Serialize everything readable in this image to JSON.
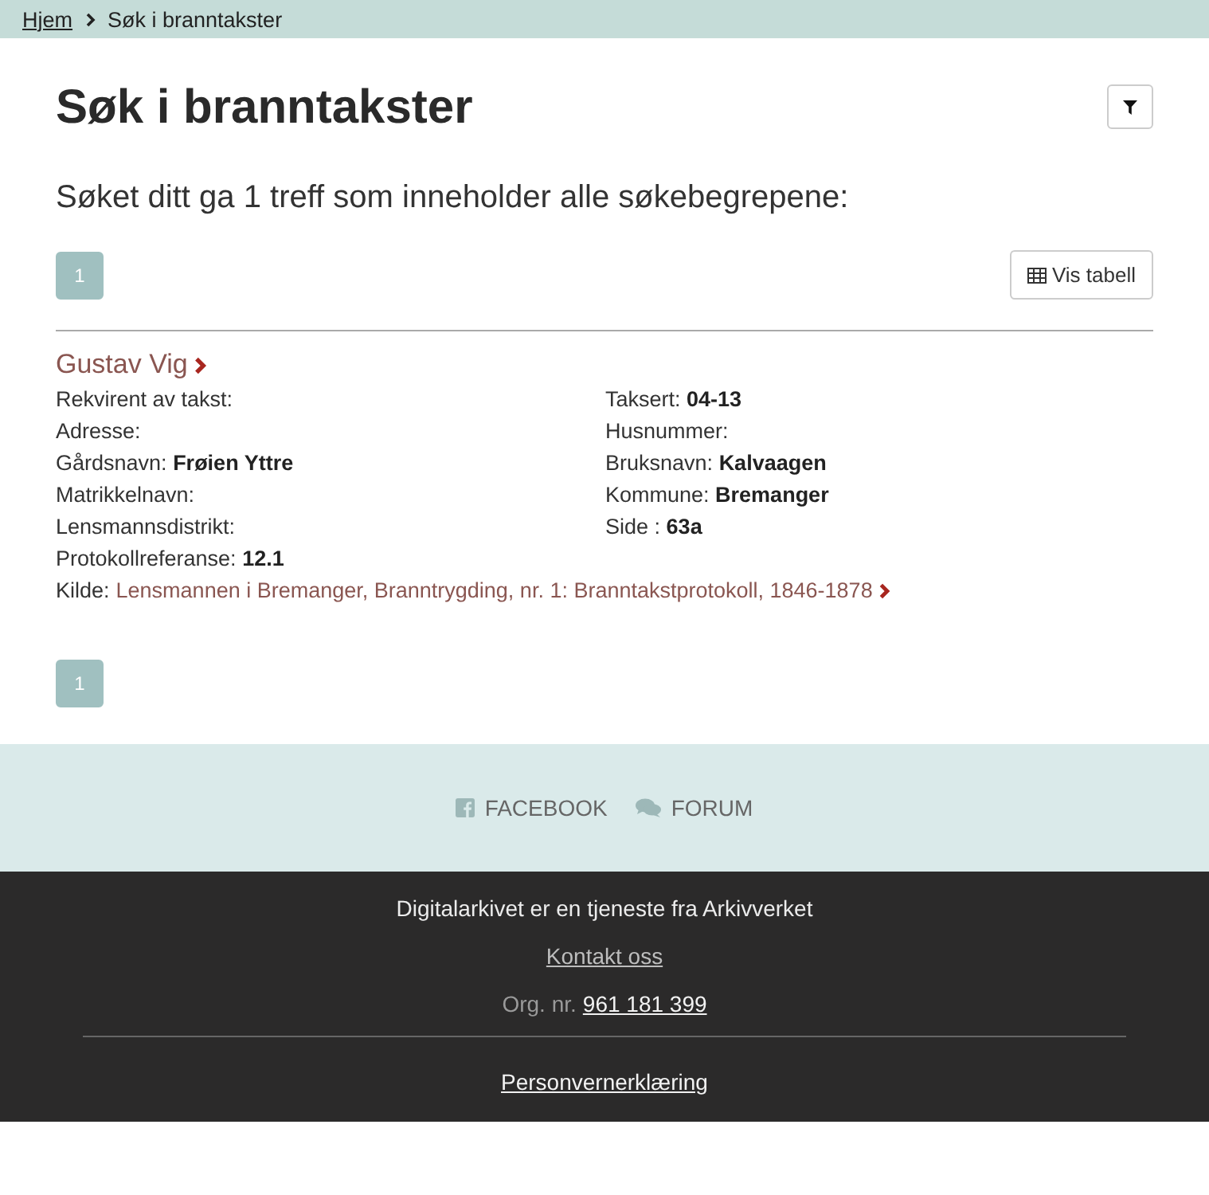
{
  "breadcrumb": [
    {
      "label": "Hjem",
      "kind": "link"
    },
    {
      "label": "Søk i branntakster",
      "kind": "current"
    }
  ],
  "page": {
    "title": "Søk i branntakster",
    "summary": "Søket ditt ga 1 treff som inneholder alle søkebegrepene:"
  },
  "pagination_top": [
    {
      "label": "1",
      "selected": true
    }
  ],
  "table_button": {
    "label": "Vis tabell"
  },
  "results": [
    {
      "name": "Gustav Vig",
      "fields_left": [
        {
          "label": "Rekvirent av takst:"
        },
        {
          "label": "Adresse:"
        },
        {
          "label": "Gårdsnavn:",
          "value": "Frøien Yttre"
        },
        {
          "label": "Matrikkelnavn:"
        },
        {
          "label": "Lensmannsdistrikt:"
        },
        {
          "label": "Protokollreferanse:",
          "value": "12.1"
        }
      ],
      "fields_right": [
        {
          "label": "Taksert:",
          "value": "04-13"
        },
        {
          "label": "Husnummer:"
        },
        {
          "label": "Bruksnavn:",
          "value": "Kalvaagen"
        },
        {
          "label": "Kommune:",
          "value": "Bremanger"
        },
        {
          "label": "Side :",
          "value": "63a"
        }
      ],
      "source": {
        "label": "Kilde:",
        "link": "Lensmannen i Bremanger, Branntrygding, nr. 1: Branntakstprotokoll, 1846-1878"
      }
    }
  ],
  "pagination_bottom": [
    {
      "label": "1",
      "selected": true
    }
  ],
  "social_links": [
    {
      "label": "FACEBOOK",
      "kind": "facebook"
    },
    {
      "label": "FORUM",
      "kind": "forum"
    }
  ],
  "footer": {
    "text": "Digitalarkivet er en tjeneste fra Arkivverket",
    "contact_link": "Kontakt oss",
    "org_label": "Org. nr.",
    "org_number": "961 181 399",
    "privacy_link": "Personvernerklæring"
  }
}
